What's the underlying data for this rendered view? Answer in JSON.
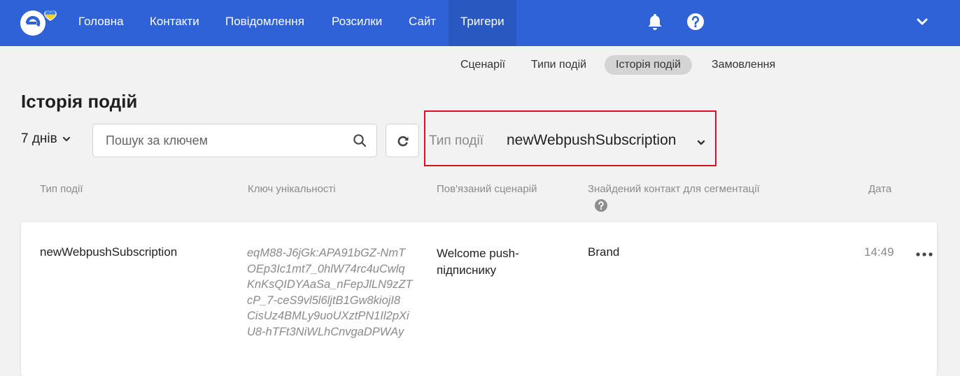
{
  "colors": {
    "topbar": "#2f62d6",
    "highlight_border": "#e0101a"
  },
  "nav": {
    "items": [
      "Головна",
      "Контакти",
      "Повідомлення",
      "Розсилки",
      "Сайт",
      "Тригери"
    ],
    "active": "Тригери"
  },
  "subnav": {
    "items": [
      "Сценарії",
      "Типи подій",
      "Історія подій",
      "Замовлення"
    ],
    "active": "Історія подій"
  },
  "page": {
    "title": "Історія подій"
  },
  "filters": {
    "period": "7 днів",
    "search_placeholder": "Пошук за ключем",
    "search_value": "",
    "type_label": "Тип події",
    "type_value": "newWebpushSubscription"
  },
  "table": {
    "headers": [
      "Тип події",
      "Ключ унікальності",
      "Пов'язаний сценарій",
      "Знайдений контакт для сегментації",
      "Дата"
    ],
    "rows": [
      {
        "type": "newWebpushSubscription",
        "key_lines": [
          "eqM88-J6jGk:APA91bGZ-NmT",
          "OEp3Ic1mt7_0hlW74rc4uCwlq",
          "KnKsQIDYAaSa_nFepJlLN9zZT",
          "cP_7-ceS9vl5l6ljtB1Gw8kiojI8",
          "CisUz4BMLy9uoUXztPN1Il2pXi",
          "U8-hTFt3NiWLhCnvgaDPWAy"
        ],
        "scenario_lines": [
          "Welcome push-",
          "підписнику"
        ],
        "contact": "Brand",
        "date": "14:49"
      }
    ]
  }
}
